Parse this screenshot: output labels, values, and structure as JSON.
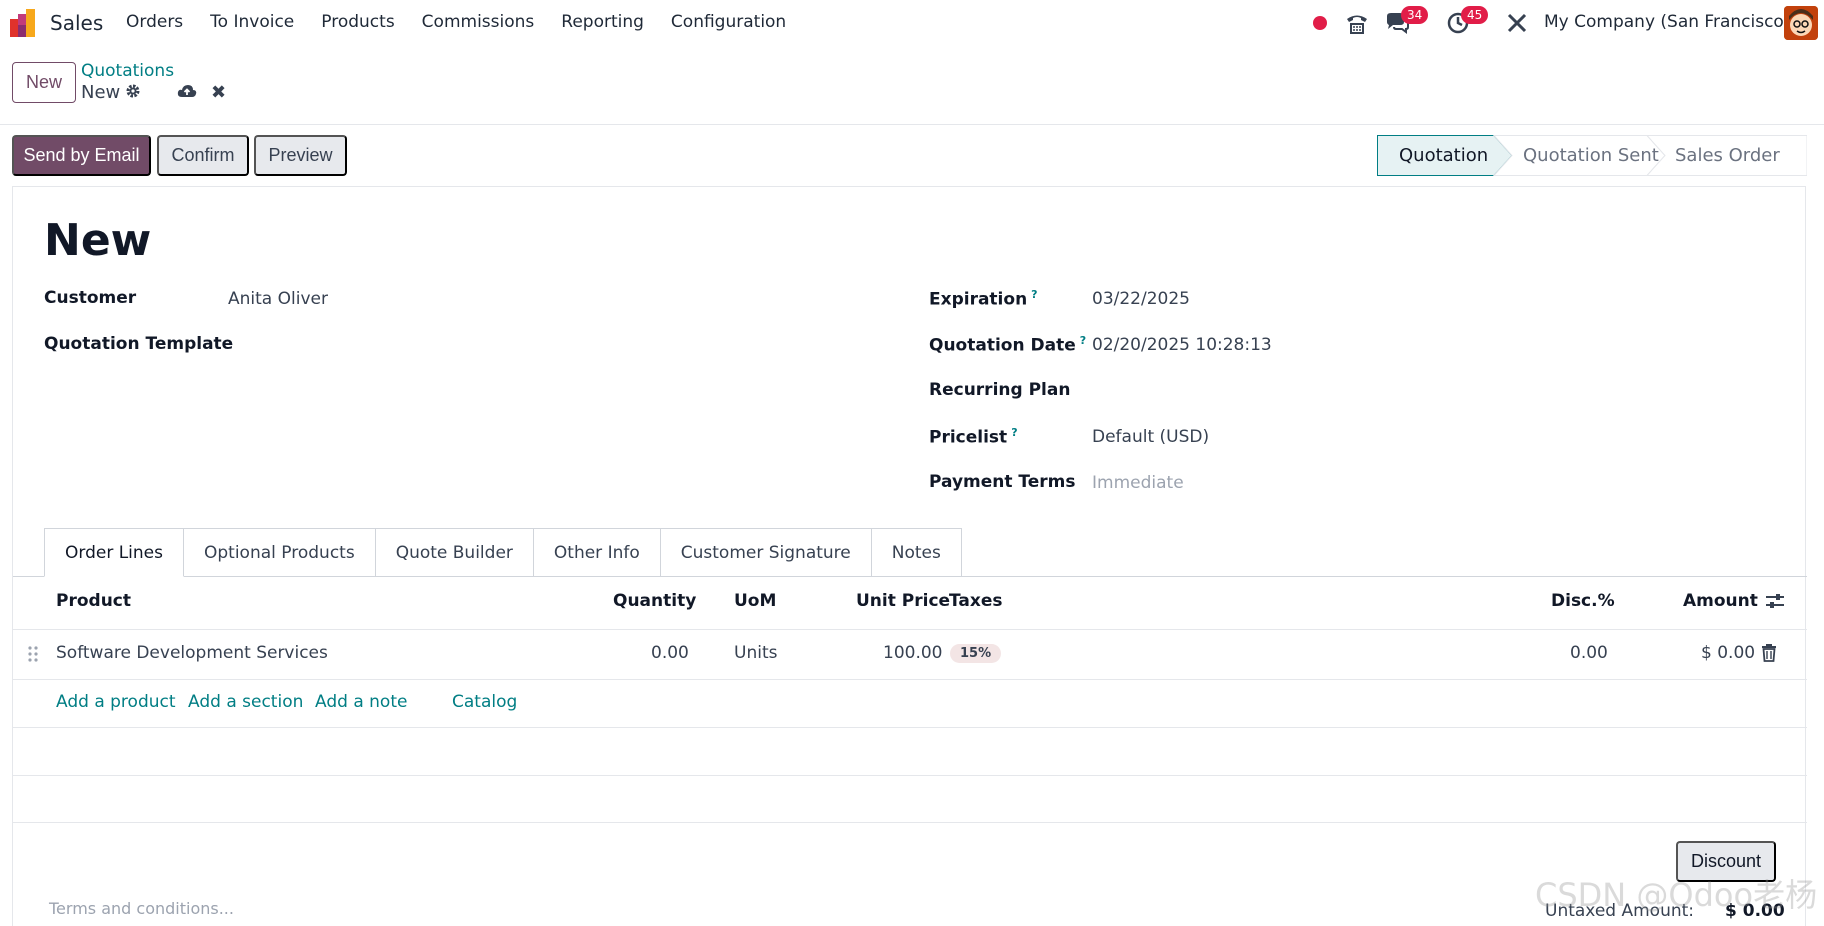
{
  "navbar": {
    "app_name": "Sales",
    "menu": [
      "Orders",
      "To Invoice",
      "Products",
      "Commissions",
      "Reporting",
      "Configuration"
    ],
    "messages_count": "34",
    "activities_count": "45",
    "company": "My Company (San Francisco)"
  },
  "control_panel": {
    "new_button": "New",
    "breadcrumb_parent": "Quotations",
    "breadcrumb_current": "New"
  },
  "statusbar": {
    "send_email": "Send by Email",
    "confirm": "Confirm",
    "preview": "Preview",
    "stages": [
      "Quotation",
      "Quotation Sent",
      "Sales Order"
    ],
    "active_stage": "Quotation"
  },
  "form": {
    "title": "New",
    "customer_label": "Customer",
    "customer_value": "Anita Oliver",
    "template_label": "Quotation Template",
    "expiration_label": "Expiration",
    "expiration_value": "03/22/2025",
    "quotation_date_label": "Quotation Date",
    "quotation_date_value": "02/20/2025 10:28:13",
    "recurring_plan_label": "Recurring Plan",
    "pricelist_label": "Pricelist",
    "pricelist_value": "Default (USD)",
    "payment_terms_label": "Payment Terms",
    "payment_terms_placeholder": "Immediate",
    "help_mark": "?"
  },
  "tabs": [
    "Order Lines",
    "Optional Products",
    "Quote Builder",
    "Other Info",
    "Customer Signature",
    "Notes"
  ],
  "table": {
    "headers": {
      "product": "Product",
      "quantity": "Quantity",
      "uom": "UoM",
      "unit_price": "Unit Price",
      "taxes": "Taxes",
      "disc": "Disc.%",
      "amount": "Amount"
    },
    "rows": [
      {
        "product": "Software Development Services",
        "quantity": "0.00",
        "uom": "Units",
        "unit_price": "100.00",
        "taxes": "15%",
        "disc": "0.00",
        "amount": "$ 0.00"
      }
    ],
    "add_product": "Add a product",
    "add_section": "Add a section",
    "add_note": "Add a note",
    "catalog": "Catalog"
  },
  "footer": {
    "discount": "Discount",
    "terms_placeholder": "Terms and conditions...",
    "untaxed_label": "Untaxed Amount:",
    "untaxed_value": "$ 0.00"
  },
  "watermark": "CSDN @Odoo老杨",
  "colors": {
    "brand": "#714b67",
    "link": "#017e84",
    "badge": "#e11d48"
  }
}
